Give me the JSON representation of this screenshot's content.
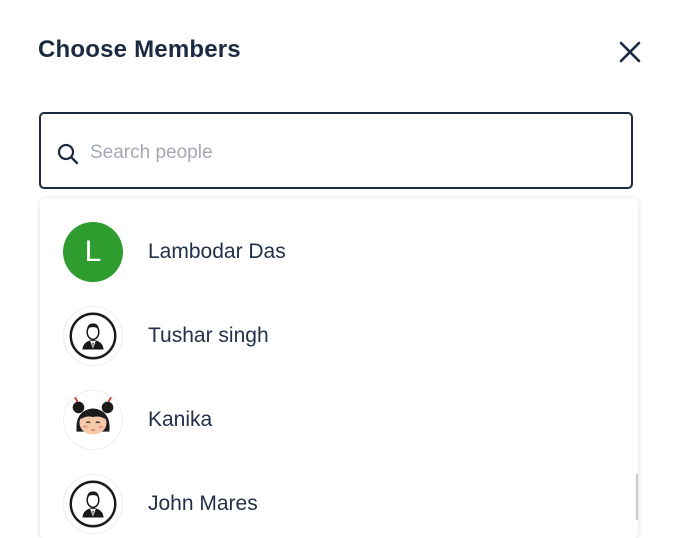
{
  "dialog": {
    "title": "Choose Members",
    "close_icon": "close-icon"
  },
  "search": {
    "placeholder": "Search people",
    "value": "",
    "icon": "search-icon"
  },
  "members": [
    {
      "name": "Lambodar Das",
      "avatar_type": "letter",
      "avatar_letter": "L",
      "avatar_color": "#2e9c2e"
    },
    {
      "name": "Tushar singh",
      "avatar_type": "image",
      "avatar_icon": "businessman-avatar"
    },
    {
      "name": "Kanika",
      "avatar_type": "image",
      "avatar_icon": "girl-avatar"
    },
    {
      "name": "John Mares",
      "avatar_type": "image",
      "avatar_icon": "businessman-avatar"
    }
  ],
  "colors": {
    "text": "#1b2a41",
    "placeholder": "#a3a9b3",
    "accent_green": "#2e9c2e"
  }
}
